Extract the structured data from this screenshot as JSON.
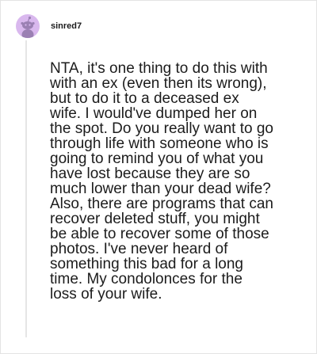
{
  "comment": {
    "username": "sinred7",
    "avatar": "reddit-snoo-avatar-icon",
    "text": "NTA, it's one thing to do this with\nwith an ex (even then its wrong),\nbut to do it to a deceased ex\nwife. I would've dumped her on\nthe spot. Do you really want to go\nthrough life with someone who is\ngoing to remind you of what you\nhave lost because they are so\nmuch lower than your dead wife?\nAlso, there are programs that can\nrecover deleted stuff, you might\nbe able to recover some of those\nphotos. I've never heard of\nsomething this bad for a long\ntime. My condolonces for the\nloss of your wife."
  },
  "colors": {
    "avatar_bg": "#d9b8ee",
    "snoo_body": "#9b80b3",
    "text": "#1c1c1c",
    "thread_line": "#e6e6e6"
  }
}
